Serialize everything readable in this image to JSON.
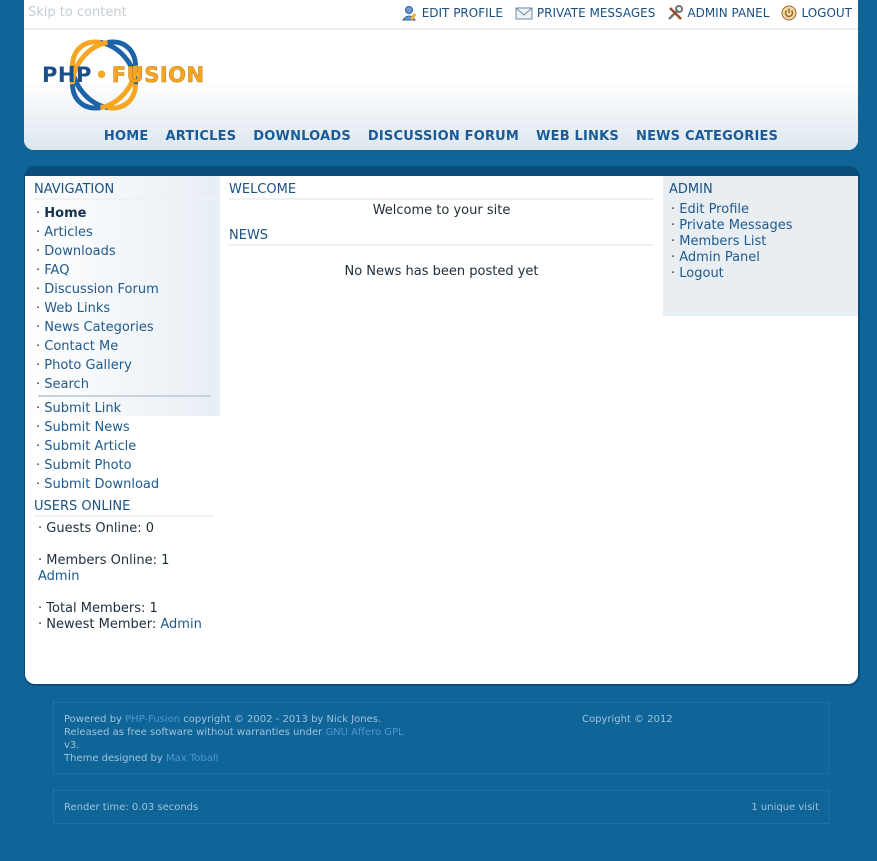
{
  "header": {
    "skip_link": "Skip to content",
    "user_links": [
      {
        "label": "EDIT PROFILE",
        "icon": "edit-profile-icon"
      },
      {
        "label": "PRIVATE MESSAGES",
        "icon": "envelope-icon"
      },
      {
        "label": "ADMIN PANEL",
        "icon": "tools-icon"
      },
      {
        "label": "LOGOUT",
        "icon": "power-icon"
      }
    ],
    "logo": {
      "php": "PHP",
      "dot": "•",
      "fusion": "FUSION"
    },
    "nav": [
      "HOME",
      "ARTICLES",
      "DOWNLOADS",
      "DISCUSSION FORUM",
      "WEB LINKS",
      "NEWS CATEGORIES"
    ]
  },
  "sidebar": {
    "navigation_title": "NAVIGATION",
    "nav_items": [
      "Home",
      "Articles",
      "Downloads",
      "FAQ",
      "Discussion Forum",
      "Web Links",
      "News Categories",
      "Contact Me",
      "Photo Gallery",
      "Search"
    ],
    "submit_items": [
      "Submit Link",
      "Submit News",
      "Submit Article",
      "Submit Photo",
      "Submit Download"
    ],
    "users_online": {
      "title": "USERS ONLINE",
      "guests_label": "Guests Online: ",
      "guests_value": "0",
      "members_label": "Members Online: ",
      "members_value": "1",
      "members_list": "Admin",
      "total_label": "Total Members: ",
      "total_value": "1",
      "newest_label": "Newest Member: ",
      "newest_value": "Admin"
    }
  },
  "center": {
    "welcome_title": "WELCOME",
    "welcome_text": "Welcome to your site",
    "news_title": "NEWS",
    "news_text": "No News has been posted yet"
  },
  "admin_panel": {
    "title": "ADMIN",
    "items": [
      "Edit Profile",
      "Private Messages",
      "Members List",
      "Admin Panel",
      "Logout"
    ]
  },
  "footer": {
    "powered_prefix": "Powered by ",
    "powered_link": "PHP-Fusion",
    "powered_suffix": " copyright © 2002 - 2013 by Nick Jones.",
    "released_prefix": "Released as free software without warranties under ",
    "license_link": "GNU Affero GPL",
    "license_version": "v3.",
    "designed_prefix": "Theme designed by ",
    "designer_link": "Max Toball",
    "copyright": "Copyright © 2012",
    "render_time": "Render time: 0.03 seconds",
    "unique_visits": "1 unique visit"
  },
  "colors": {
    "background": "#0f6498",
    "link": "#1a5a96",
    "logo_orange": "#f5a623",
    "logo_blue": "#1b4f8a"
  }
}
